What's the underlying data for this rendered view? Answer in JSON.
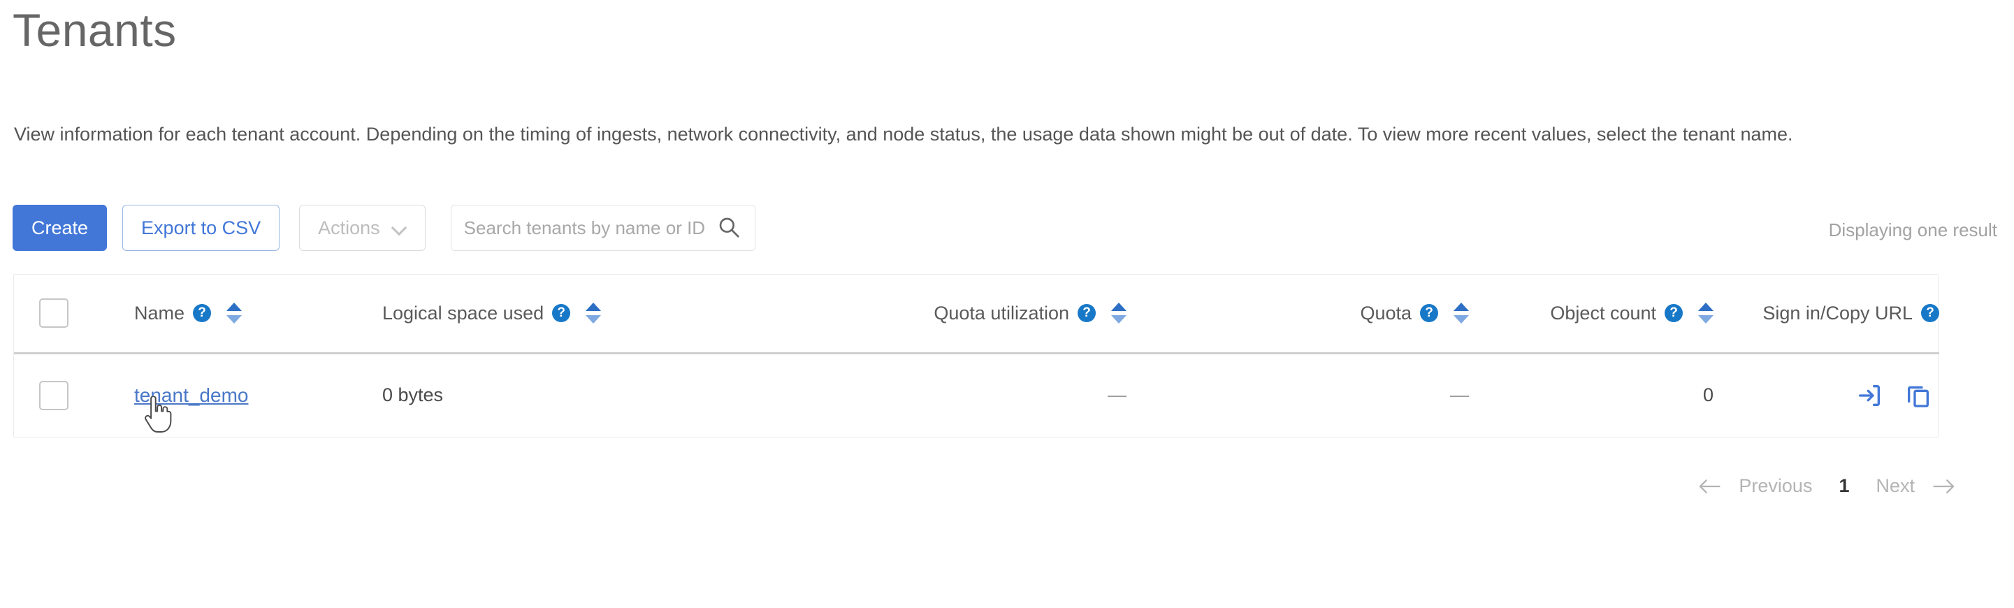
{
  "page": {
    "title": "Tenants",
    "description": "View information for each tenant account. Depending on the timing of ingests, network connectivity, and node status, the usage data shown might be out of date. To view more recent values, select the tenant name."
  },
  "toolbar": {
    "create_label": "Create",
    "export_label": "Export to CSV",
    "actions_label": "Actions",
    "actions_chevron_icon": "chevron-down-icon",
    "search_placeholder": "Search tenants by name or ID",
    "search_value": "",
    "search_icon": "search-icon",
    "result_count": "Displaying one result"
  },
  "table": {
    "columns": [
      {
        "label": "Name",
        "help": true,
        "sortable": true,
        "align": "left"
      },
      {
        "label": "Logical space used",
        "help": true,
        "sortable": true,
        "align": "left"
      },
      {
        "label": "Quota utilization",
        "help": true,
        "sortable": true,
        "align": "right"
      },
      {
        "label": "Quota",
        "help": true,
        "sortable": true,
        "align": "right"
      },
      {
        "label": "Object count",
        "help": true,
        "sortable": true,
        "align": "right"
      },
      {
        "label": "Sign in/Copy URL",
        "help": true,
        "sortable": false,
        "align": "right"
      }
    ],
    "help_icon_glyph": "?",
    "rows": [
      {
        "selected": false,
        "name": "tenant_demo",
        "logical_space_used": "0 bytes",
        "quota_utilization": "—",
        "quota": "—",
        "object_count": "0",
        "sign_in_icon": "sign-in-icon",
        "copy_url_icon": "copy-icon"
      }
    ]
  },
  "pagination": {
    "previous_label": "Previous",
    "next_label": "Next",
    "current_page": "1",
    "prev_icon": "arrow-left-icon",
    "next_icon": "arrow-right-icon"
  },
  "colors": {
    "primary_blue": "#4277d8",
    "link_blue": "#4a78c8",
    "help_blue": "#1878c8",
    "sort_up": "#2d6fc4",
    "sort_down": "#7fa9e0",
    "muted_text": "#a8a8a8"
  }
}
